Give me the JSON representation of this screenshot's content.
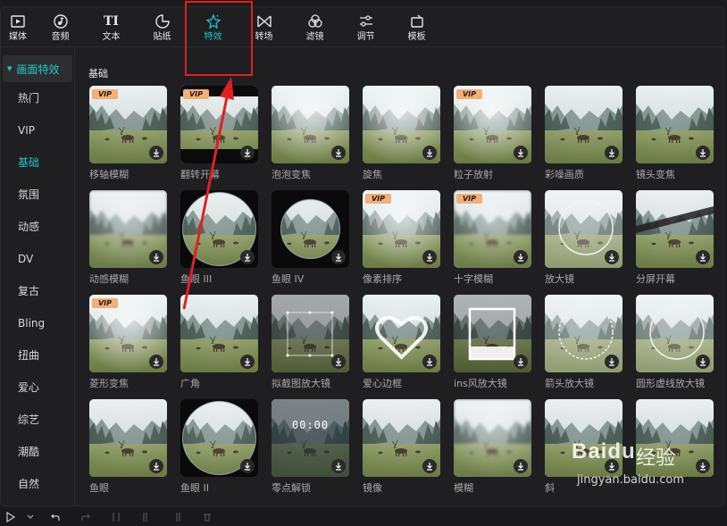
{
  "tabs": [
    {
      "label": "媒体",
      "icon": "media-icon"
    },
    {
      "label": "音频",
      "icon": "audio-icon"
    },
    {
      "label": "文本",
      "icon": "text-icon"
    },
    {
      "label": "贴纸",
      "icon": "sticker-icon"
    },
    {
      "label": "特效",
      "icon": "effects-icon",
      "active": true
    },
    {
      "label": "转场",
      "icon": "transition-icon"
    },
    {
      "label": "滤镜",
      "icon": "filter-icon"
    },
    {
      "label": "调节",
      "icon": "adjust-icon"
    },
    {
      "label": "模板",
      "icon": "template-icon"
    }
  ],
  "tab_text_icon": "TI",
  "sidebar": {
    "header": "画面特效",
    "items": [
      "热门",
      "VIP",
      "基础",
      "氛围",
      "动感",
      "DV",
      "复古",
      "Bling",
      "扭曲",
      "爱心",
      "综艺",
      "潮酷",
      "自然"
    ],
    "active_index": 2
  },
  "section_title": "基础",
  "vip_label": "VIP",
  "cards": [
    {
      "name": "移轴模糊",
      "vip": true,
      "style": "normal"
    },
    {
      "name": "翻转开幕",
      "vip": true,
      "style": "letterbox"
    },
    {
      "name": "泡泡变焦",
      "vip": false,
      "style": "foggy"
    },
    {
      "name": "旋焦",
      "vip": false,
      "style": "foggy"
    },
    {
      "name": "粒子放射",
      "vip": true,
      "style": "foggy"
    },
    {
      "name": "彩噪画质",
      "vip": false,
      "style": "normal"
    },
    {
      "name": "镜头变焦",
      "vip": false,
      "style": "normal"
    },
    {
      "name": "动感模糊",
      "vip": false,
      "style": "blur"
    },
    {
      "name": "鱼眼 III",
      "vip": false,
      "style": "fisheye"
    },
    {
      "name": "鱼眼 IV",
      "vip": false,
      "style": "fisheye-small"
    },
    {
      "name": "像素排序",
      "vip": true,
      "style": "foggy"
    },
    {
      "name": "十字模糊",
      "vip": true,
      "style": "blur"
    },
    {
      "name": "放大镜",
      "vip": false,
      "style": "magnifier"
    },
    {
      "name": "分屏开幕",
      "vip": false,
      "style": "split"
    },
    {
      "name": "菱形变焦",
      "vip": true,
      "style": "foggy"
    },
    {
      "name": "广角",
      "vip": false,
      "style": "normal"
    },
    {
      "name": "拟截图放大镜",
      "vip": false,
      "style": "crop"
    },
    {
      "name": "爱心边框",
      "vip": false,
      "style": "heart"
    },
    {
      "name": "ins风放大镜",
      "vip": false,
      "style": "polaroid"
    },
    {
      "name": "箭头放大镜",
      "vip": false,
      "style": "magnifier"
    },
    {
      "name": "圆形虚线放大镜",
      "vip": false,
      "style": "magnifier"
    },
    {
      "name": "鱼眼",
      "vip": false,
      "style": "normal"
    },
    {
      "name": "鱼眼 II",
      "vip": false,
      "style": "fisheye"
    },
    {
      "name": "零点解锁",
      "vip": false,
      "style": "clock"
    },
    {
      "name": "镜像",
      "vip": false,
      "style": "normal"
    },
    {
      "name": "模糊",
      "vip": false,
      "style": "blur"
    },
    {
      "name": "斜",
      "vip": false,
      "style": "normal"
    },
    {
      "name": "",
      "vip": false,
      "style": "normal"
    }
  ],
  "clock_text": "00:00",
  "watermark": {
    "brand": "Baidu",
    "suffix": "经验",
    "url": "jingyan.baidu.com"
  },
  "colors": {
    "accent": "#1fc8c8",
    "vip_badge": "#f1b07a",
    "annotation": "#e02020"
  }
}
